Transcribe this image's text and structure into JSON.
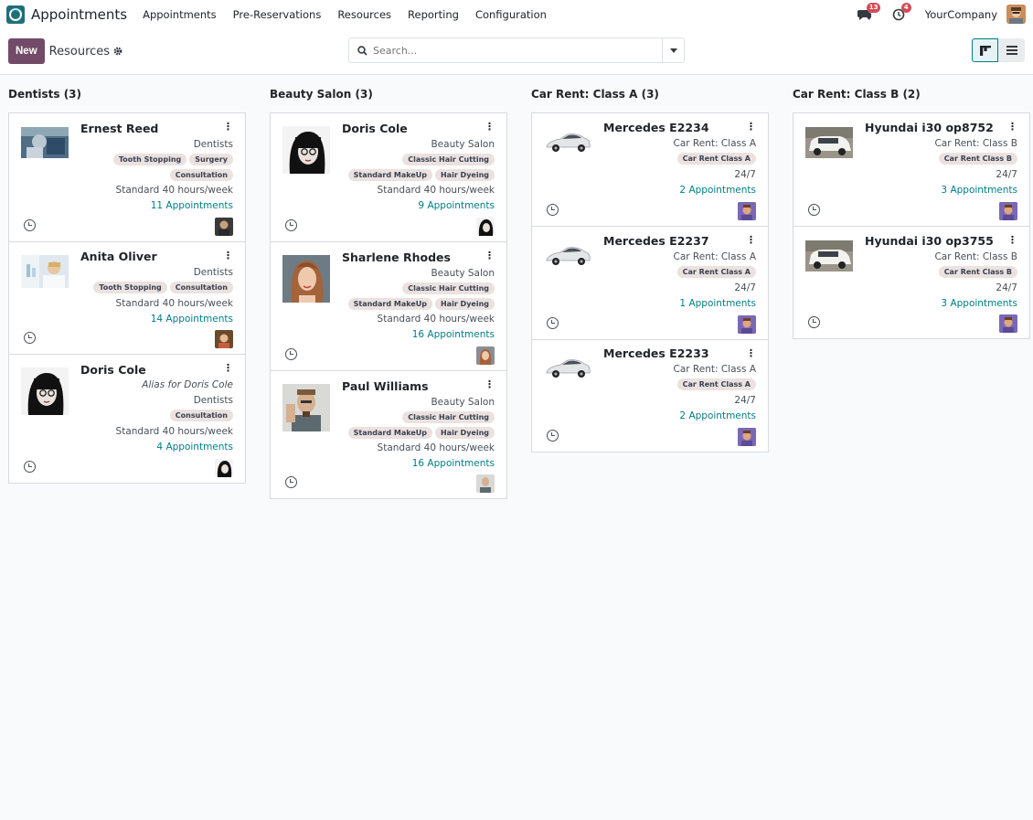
{
  "navbar": {
    "app_name": "Appointments",
    "menu": [
      "Appointments",
      "Pre-Reservations",
      "Resources",
      "Reporting",
      "Configuration"
    ],
    "messages_count": "13",
    "activities_count": "4",
    "company": "YourCompany"
  },
  "control_panel": {
    "new_label": "New",
    "breadcrumb": "Resources",
    "search_placeholder": "Search..."
  },
  "columns": [
    {
      "title": "Dentists (3)",
      "cards": [
        {
          "name": "Ernest Reed",
          "category": "Dentists",
          "tags": [
            [
              "Tooth Stopping",
              "Surgery"
            ],
            [
              "Consultation"
            ]
          ],
          "schedule": "Standard 40 hours/week",
          "appointments": "11 Appointments"
        },
        {
          "name": "Anita Oliver",
          "category": "Dentists",
          "tags": [
            [
              "Tooth Stopping",
              "Consultation"
            ]
          ],
          "schedule": "Standard 40 hours/week",
          "appointments": "14 Appointments"
        },
        {
          "name": "Doris Cole",
          "alias": "Alias for Doris Cole",
          "category": "Dentists",
          "tags": [
            [
              "Consultation"
            ]
          ],
          "schedule": "Standard 40 hours/week",
          "appointments": "4 Appointments"
        }
      ]
    },
    {
      "title": "Beauty Salon (3)",
      "cards": [
        {
          "name": "Doris Cole",
          "category": "Beauty Salon",
          "tags": [
            [
              "Classic Hair Cutting"
            ],
            [
              "Standard MakeUp",
              "Hair Dyeing"
            ]
          ],
          "schedule": "Standard 40 hours/week",
          "appointments": "9 Appointments"
        },
        {
          "name": "Sharlene Rhodes",
          "category": "Beauty Salon",
          "tags": [
            [
              "Classic Hair Cutting"
            ],
            [
              "Standard MakeUp",
              "Hair Dyeing"
            ]
          ],
          "schedule": "Standard 40 hours/week",
          "appointments": "16 Appointments"
        },
        {
          "name": "Paul Williams",
          "category": "Beauty Salon",
          "tags": [
            [
              "Classic Hair Cutting"
            ],
            [
              "Standard MakeUp",
              "Hair Dyeing"
            ]
          ],
          "schedule": "Standard 40 hours/week",
          "appointments": "16 Appointments"
        }
      ]
    },
    {
      "title": "Car Rent: Class A (3)",
      "cards": [
        {
          "name": "Mercedes E2234",
          "category": "Car Rent: Class A",
          "tags": [
            [
              "Car Rent Class A"
            ]
          ],
          "schedule": "24/7",
          "appointments": "2 Appointments"
        },
        {
          "name": "Mercedes E2237",
          "category": "Car Rent: Class A",
          "tags": [
            [
              "Car Rent Class A"
            ]
          ],
          "schedule": "24/7",
          "appointments": "1 Appointments"
        },
        {
          "name": "Mercedes E2233",
          "category": "Car Rent: Class A",
          "tags": [
            [
              "Car Rent Class A"
            ]
          ],
          "schedule": "24/7",
          "appointments": "2 Appointments"
        }
      ]
    },
    {
      "title": "Car Rent: Class B (2)",
      "cards": [
        {
          "name": "Hyundai i30 op8752",
          "category": "Car Rent: Class B",
          "tags": [
            [
              "Car Rent Class B"
            ]
          ],
          "schedule": "24/7",
          "appointments": "3 Appointments"
        },
        {
          "name": "Hyundai i30 op3755",
          "category": "Car Rent: Class B",
          "tags": [
            [
              "Car Rent Class B"
            ]
          ],
          "schedule": "24/7",
          "appointments": "3 Appointments"
        }
      ]
    }
  ],
  "colors": {
    "brand": "#714b67",
    "link": "#017e84",
    "tag_bg": "#ebe1df",
    "badge": "#d44c59"
  }
}
